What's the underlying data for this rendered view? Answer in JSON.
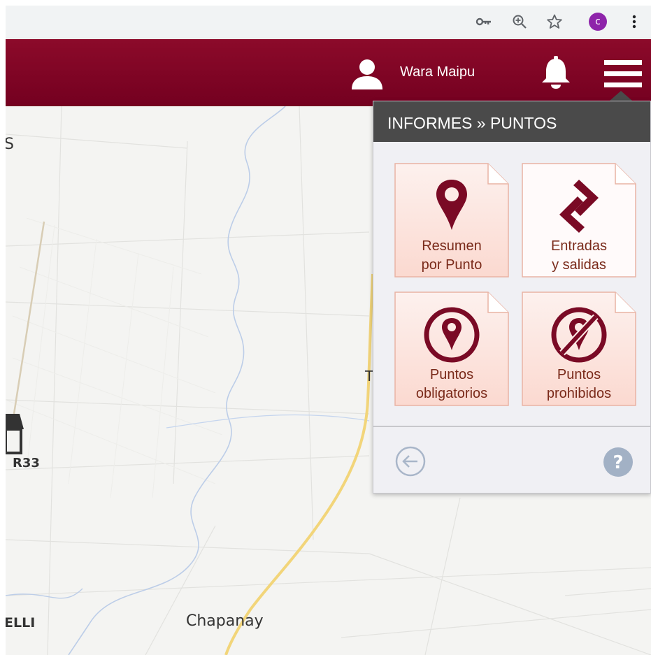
{
  "browser": {
    "toolbar_icons": [
      "key-icon",
      "zoom-icon",
      "star-icon",
      "profile-avatar",
      "more-vert-icon"
    ],
    "profile_initial": "c",
    "profile_color": "#8e24aa"
  },
  "header": {
    "user_name": "Wara Maipu",
    "background_color": "#7f0a25",
    "icons": [
      "user-icon",
      "bell-icon",
      "hamburger-menu-icon"
    ]
  },
  "map": {
    "labels": {
      "top_left": "S",
      "route": "R33",
      "bottom_left": "ELLI",
      "town": "Chapanay",
      "mid_right": "T"
    }
  },
  "menu": {
    "breadcrumb": "INFORMES » PUNTOS",
    "accent_color": "#7f0a25",
    "tiles": [
      {
        "line1": "Resumen",
        "line2": "por Punto",
        "icon": "map-pin-icon"
      },
      {
        "line1": "Entradas",
        "line2": "y salidas",
        "icon": "enter-exit-arrows-icon"
      },
      {
        "line1": "Puntos",
        "line2": "obligatorios",
        "icon": "mandatory-point-icon"
      },
      {
        "line1": "Puntos",
        "line2": "prohibidos",
        "icon": "forbidden-point-icon"
      }
    ],
    "footer_icons": [
      "back-arrow-icon",
      "help-icon"
    ],
    "help_glyph": "?"
  }
}
